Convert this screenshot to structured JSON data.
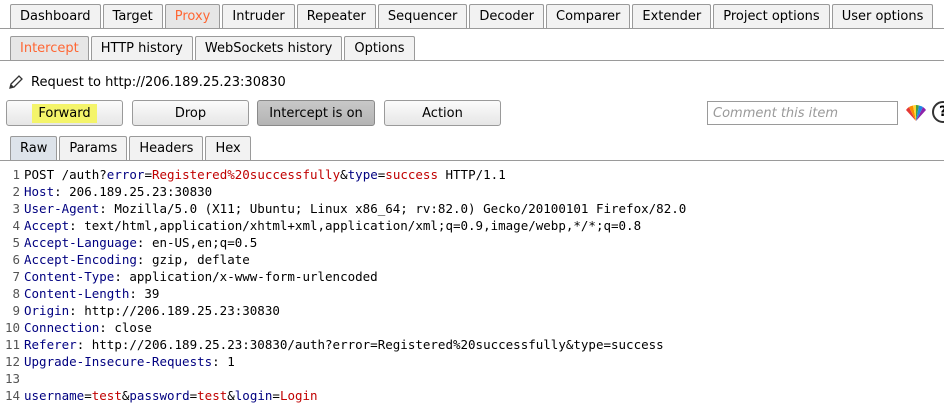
{
  "top_tabs": [
    {
      "label": "Dashboard",
      "active": false
    },
    {
      "label": "Target",
      "active": false
    },
    {
      "label": "Proxy",
      "active": true
    },
    {
      "label": "Intruder",
      "active": false
    },
    {
      "label": "Repeater",
      "active": false
    },
    {
      "label": "Sequencer",
      "active": false
    },
    {
      "label": "Decoder",
      "active": false
    },
    {
      "label": "Comparer",
      "active": false
    },
    {
      "label": "Extender",
      "active": false
    },
    {
      "label": "Project options",
      "active": false
    },
    {
      "label": "User options",
      "active": false
    }
  ],
  "sub_tabs": [
    {
      "label": "Intercept",
      "active": true
    },
    {
      "label": "HTTP history",
      "active": false
    },
    {
      "label": "WebSockets history",
      "active": false
    },
    {
      "label": "Options",
      "active": false
    }
  ],
  "request_line": "Request to http://206.189.25.23:30830",
  "buttons": {
    "forward": "Forward",
    "drop": "Drop",
    "intercept": "Intercept is on",
    "action": "Action"
  },
  "comment": {
    "placeholder": "Comment this item",
    "value": ""
  },
  "help_label": "?",
  "editor_tabs": [
    {
      "label": "Raw",
      "active": true
    },
    {
      "label": "Params",
      "active": false
    },
    {
      "label": "Headers",
      "active": false
    },
    {
      "label": "Hex",
      "active": false
    }
  ],
  "request_lines": [
    {
      "n": "1",
      "parts": [
        {
          "t": "POST /auth?",
          "c": "txt"
        },
        {
          "t": "error",
          "c": "p"
        },
        {
          "t": "=",
          "c": "txt"
        },
        {
          "t": "Registered%20successfully",
          "c": "v"
        },
        {
          "t": "&",
          "c": "txt"
        },
        {
          "t": "type",
          "c": "p"
        },
        {
          "t": "=",
          "c": "txt"
        },
        {
          "t": "success",
          "c": "v"
        },
        {
          "t": " HTTP/1.1",
          "c": "txt"
        }
      ]
    },
    {
      "n": "2",
      "parts": [
        {
          "t": "Host",
          "c": "k"
        },
        {
          "t": ": 206.189.25.23:30830",
          "c": "txt"
        }
      ]
    },
    {
      "n": "3",
      "parts": [
        {
          "t": "User-Agent",
          "c": "k"
        },
        {
          "t": ": Mozilla/5.0 (X11; Ubuntu; Linux x86_64; rv:82.0) Gecko/20100101 Firefox/82.0",
          "c": "txt"
        }
      ]
    },
    {
      "n": "4",
      "parts": [
        {
          "t": "Accept",
          "c": "k"
        },
        {
          "t": ": text/html,application/xhtml+xml,application/xml;q=0.9,image/webp,*/*;q=0.8",
          "c": "txt"
        }
      ]
    },
    {
      "n": "5",
      "parts": [
        {
          "t": "Accept-Language",
          "c": "k"
        },
        {
          "t": ": en-US,en;q=0.5",
          "c": "txt"
        }
      ]
    },
    {
      "n": "6",
      "parts": [
        {
          "t": "Accept-Encoding",
          "c": "k"
        },
        {
          "t": ": gzip, deflate",
          "c": "txt"
        }
      ]
    },
    {
      "n": "7",
      "parts": [
        {
          "t": "Content-Type",
          "c": "k"
        },
        {
          "t": ": application/x-www-form-urlencoded",
          "c": "txt"
        }
      ]
    },
    {
      "n": "8",
      "parts": [
        {
          "t": "Content-Length",
          "c": "k"
        },
        {
          "t": ": 39",
          "c": "txt"
        }
      ]
    },
    {
      "n": "9",
      "parts": [
        {
          "t": "Origin",
          "c": "k"
        },
        {
          "t": ": http://206.189.25.23:30830",
          "c": "txt"
        }
      ]
    },
    {
      "n": "10",
      "parts": [
        {
          "t": "Connection",
          "c": "k"
        },
        {
          "t": ": close",
          "c": "txt"
        }
      ]
    },
    {
      "n": "11",
      "parts": [
        {
          "t": "Referer",
          "c": "k"
        },
        {
          "t": ": http://206.189.25.23:30830/auth?error=Registered%20successfully&type=success",
          "c": "txt"
        }
      ]
    },
    {
      "n": "12",
      "parts": [
        {
          "t": "Upgrade-Insecure-Requests",
          "c": "k"
        },
        {
          "t": ": 1",
          "c": "txt"
        }
      ]
    },
    {
      "n": "13",
      "parts": []
    },
    {
      "n": "14",
      "parts": [
        {
          "t": "username",
          "c": "p"
        },
        {
          "t": "=",
          "c": "txt"
        },
        {
          "t": "test",
          "c": "v"
        },
        {
          "t": "&",
          "c": "txt"
        },
        {
          "t": "password",
          "c": "p"
        },
        {
          "t": "=",
          "c": "txt"
        },
        {
          "t": "test",
          "c": "v"
        },
        {
          "t": "&",
          "c": "txt"
        },
        {
          "t": "login",
          "c": "p"
        },
        {
          "t": "=",
          "c": "txt"
        },
        {
          "t": "Login",
          "c": "v"
        }
      ]
    }
  ],
  "colors": {
    "accent": "#ff6633",
    "highlight": "#f4f46a",
    "param": "#000080",
    "value": "#c00000"
  }
}
